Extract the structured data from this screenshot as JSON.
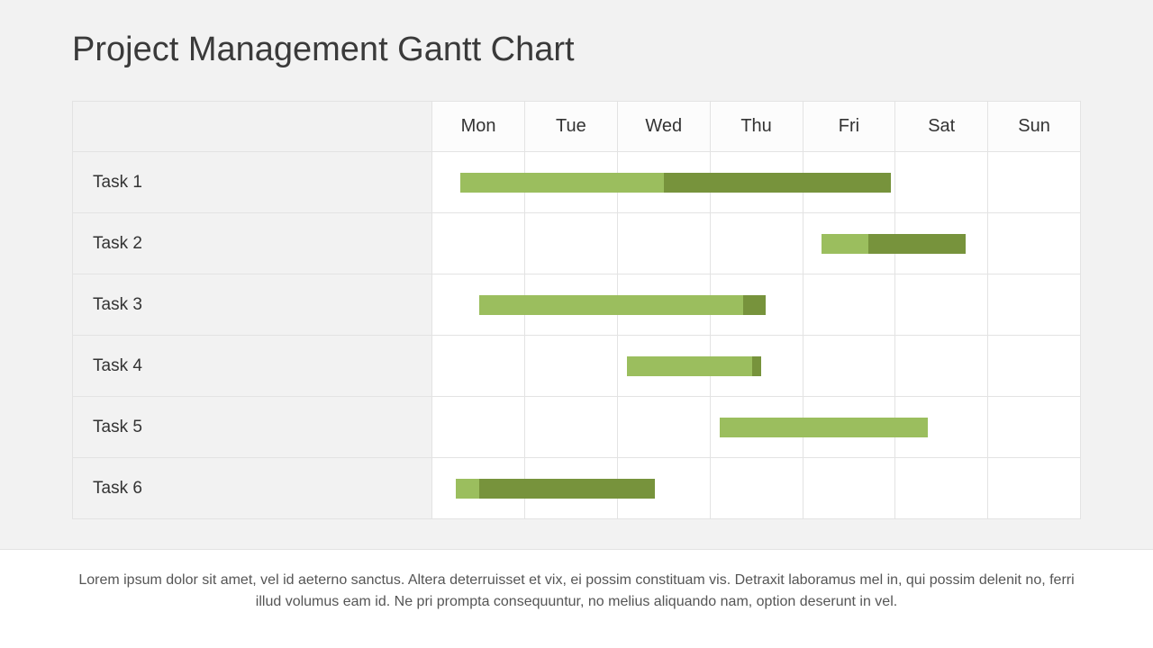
{
  "title": "Project Management Gantt Chart",
  "days": [
    "Mon",
    "Tue",
    "Wed",
    "Thu",
    "Fri",
    "Sat",
    "Sun"
  ],
  "tasks": [
    {
      "name": "Task 1",
      "start": 0.3,
      "end": 4.95,
      "split": 2.5
    },
    {
      "name": "Task 2",
      "start": 4.2,
      "end": 5.75,
      "split": 4.7
    },
    {
      "name": "Task 3",
      "start": 0.5,
      "end": 3.6,
      "split": 3.35
    },
    {
      "name": "Task 4",
      "start": 2.1,
      "end": 3.55,
      "split": 3.45
    },
    {
      "name": "Task 5",
      "start": 3.1,
      "end": 5.35,
      "split": 5.35
    },
    {
      "name": "Task 6",
      "start": 0.25,
      "end": 2.4,
      "split": 0.5
    }
  ],
  "colors": {
    "light": "#9bbe5e",
    "dark": "#77933c"
  },
  "footer_text": "Lorem ipsum dolor sit amet, vel id aeterno sanctus. Altera deterruisset et vix, ei possim constituam vis. Detraxit laboramus mel in, qui possim delenit no, ferri illud volumus eam id. Ne pri prompta consequuntur, no melius aliquando nam, option deserunt in vel.",
  "chart_data": {
    "type": "gantt",
    "title": "Project Management Gantt Chart",
    "categories": [
      "Mon",
      "Tue",
      "Wed",
      "Thu",
      "Fri",
      "Sat",
      "Sun"
    ],
    "xlabel": "",
    "ylabel": "",
    "xlim": [
      0,
      7
    ],
    "series": [
      {
        "name": "Task 1",
        "segments": [
          {
            "phase": "light",
            "start": 0.3,
            "end": 2.5
          },
          {
            "phase": "dark",
            "start": 2.5,
            "end": 4.95
          }
        ]
      },
      {
        "name": "Task 2",
        "segments": [
          {
            "phase": "light",
            "start": 4.2,
            "end": 4.7
          },
          {
            "phase": "dark",
            "start": 4.7,
            "end": 5.75
          }
        ]
      },
      {
        "name": "Task 3",
        "segments": [
          {
            "phase": "light",
            "start": 0.5,
            "end": 3.35
          },
          {
            "phase": "dark",
            "start": 3.35,
            "end": 3.6
          }
        ]
      },
      {
        "name": "Task 4",
        "segments": [
          {
            "phase": "light",
            "start": 2.1,
            "end": 3.45
          },
          {
            "phase": "dark",
            "start": 3.45,
            "end": 3.55
          }
        ]
      },
      {
        "name": "Task 5",
        "segments": [
          {
            "phase": "light",
            "start": 3.1,
            "end": 5.35
          }
        ]
      },
      {
        "name": "Task 6",
        "segments": [
          {
            "phase": "light",
            "start": 0.25,
            "end": 0.5
          },
          {
            "phase": "dark",
            "start": 0.5,
            "end": 2.4
          }
        ]
      }
    ]
  }
}
